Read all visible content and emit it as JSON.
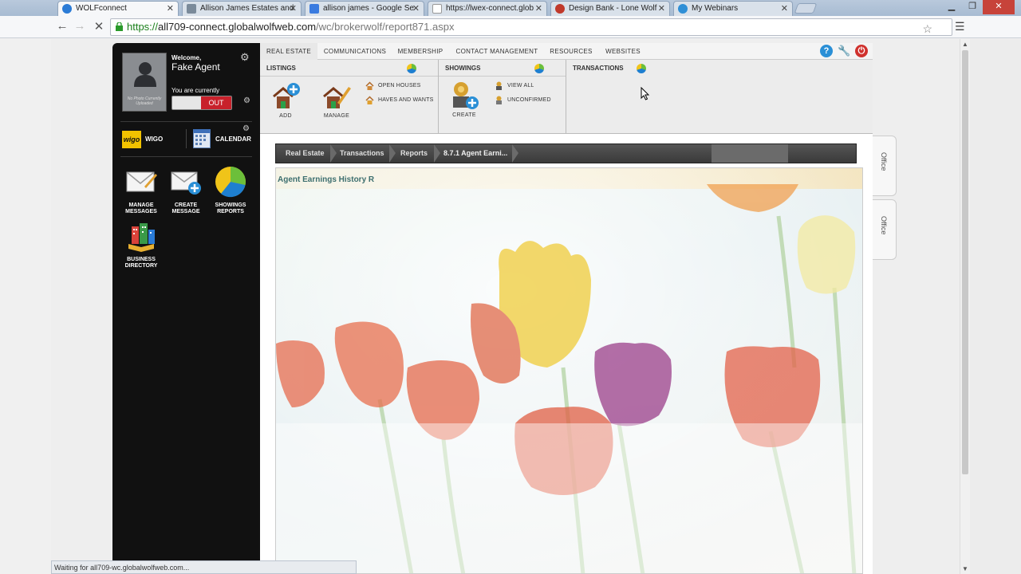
{
  "browser": {
    "tabs": [
      {
        "title": "WOLFconnect",
        "active": true,
        "favicon_color": "#2b7bd6"
      },
      {
        "title": "Allison James Estates and",
        "active": false,
        "favicon_color": "#7a8a9a"
      },
      {
        "title": "allison james - Google Se",
        "active": false,
        "favicon_color": "#3a7be0"
      },
      {
        "title": "https://lwex-connect.glob",
        "active": false,
        "favicon_color": "#cfd6df"
      },
      {
        "title": "Design Bank - Lone Wolf",
        "active": false,
        "favicon_color": "#c0392b"
      },
      {
        "title": "My Webinars",
        "active": false,
        "favicon_color": "#2f8fd6"
      }
    ],
    "url_scheme": "https://",
    "url_host": "all709-connect.globalwolfweb.com",
    "url_path": "/wc/brokerwolf/report871.aspx",
    "status_text": "Waiting for all709-wc.globalwolfweb.com..."
  },
  "sidebar": {
    "no_photo_text": "No Photo Currently Uploaded",
    "welcome_label": "Welcome,",
    "agent_name": "Fake Agent",
    "currently_label": "You are currently",
    "toggle_state": "OUT",
    "wigo_logo": "wigo",
    "wigo_label": "WIGO",
    "calendar_label": "CALENDAR",
    "apps": [
      {
        "label": "MANAGE MESSAGES",
        "icon": "envelope-pencil-icon"
      },
      {
        "label": "CREATE MESSAGE",
        "icon": "envelope-plus-icon"
      },
      {
        "label": "SHOWINGS REPORTS",
        "icon": "pie-chart-icon"
      },
      {
        "label": "BUSINESS DIRECTORY",
        "icon": "buildings-book-icon"
      }
    ]
  },
  "nav": {
    "tabs": [
      "REAL ESTATE",
      "COMMUNICATIONS",
      "MEMBERSHIP",
      "CONTACT MANAGEMENT",
      "RESOURCES",
      "WEBSITES"
    ],
    "active_tab": "REAL ESTATE"
  },
  "listings": {
    "heading": "LISTINGS",
    "add_label": "ADD",
    "manage_label": "MANAGE",
    "links": [
      "OPEN HOUSES",
      "HAVES AND WANTS"
    ]
  },
  "showings": {
    "heading": "SHOWINGS",
    "create_label": "CREATE",
    "links": [
      "VIEW ALL",
      "UNCONFIRMED"
    ]
  },
  "transactions": {
    "heading": "TRANSACTIONS"
  },
  "breadcrumb": [
    "Real Estate",
    "Transactions",
    "Reports",
    "8.7.1 Agent Earni..."
  ],
  "report": {
    "title": "Agent Earnings History R"
  },
  "side_tabs": [
    "Office",
    "Office"
  ],
  "colors": {
    "out_red": "#c8212b",
    "breadcrumb_dark": "#3a3a3a",
    "report_title": "#3d6f6f"
  }
}
